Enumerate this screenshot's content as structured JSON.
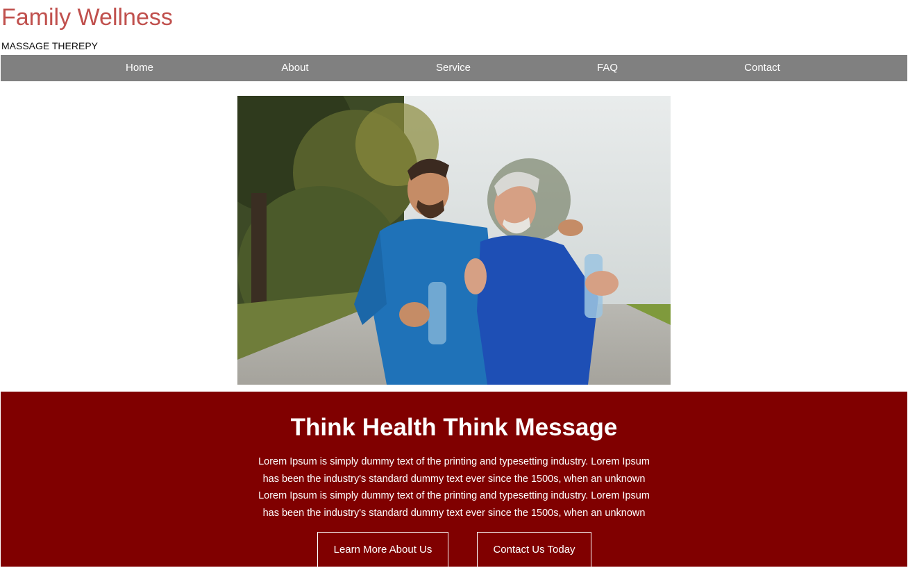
{
  "header": {
    "title": "Family Wellness",
    "subtitle": "MASSAGE THEREPY"
  },
  "nav": {
    "items": [
      "Home",
      "About",
      "Service",
      "FAQ",
      "Contact"
    ]
  },
  "hero": {
    "image_subject": "two-men-walking-outdoors-photo"
  },
  "band": {
    "title": "Think Health Think Message",
    "lines": [
      "Lorem Ipsum is simply dummy text of the printing and typesetting industry. Lorem Ipsum",
      "has been the industry's standard dummy text ever since the 1500s, when an unknown",
      "Lorem Ipsum is simply dummy text of the printing and typesetting industry. Lorem Ipsum",
      "has been the industry's standard dummy text ever since the 1500s, when an unknown"
    ],
    "learn_more_label": "Learn More About Us",
    "contact_label": "Contact Us Today"
  },
  "colors": {
    "brand_title": "#c0504d",
    "nav_bg": "#808080",
    "band_bg": "#800000",
    "text_light": "#ffffff"
  }
}
